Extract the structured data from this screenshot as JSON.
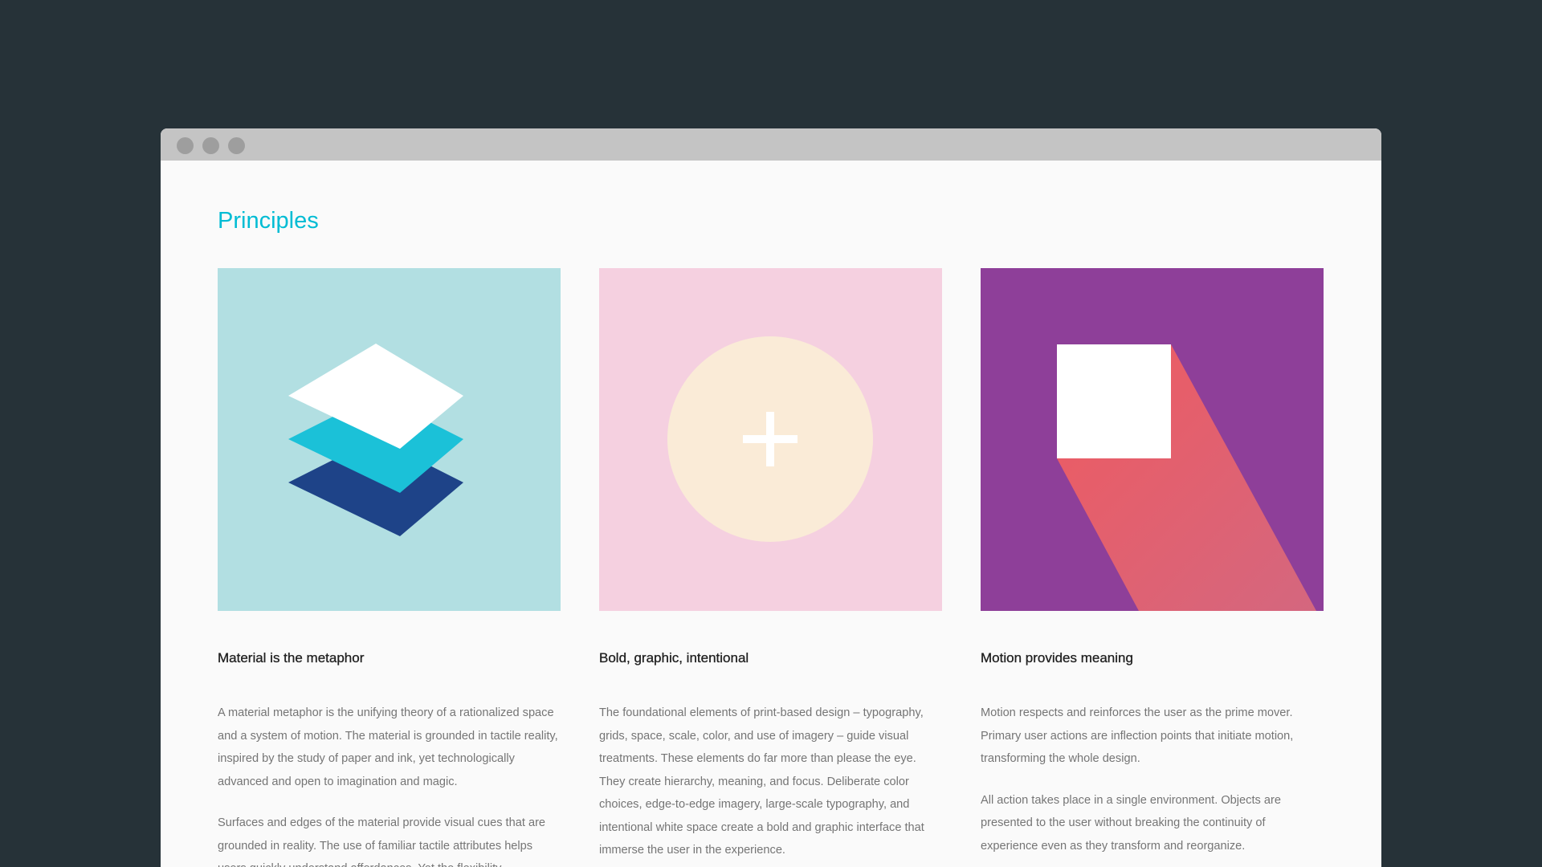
{
  "page": {
    "title": "Principles"
  },
  "window": {
    "titlebar_color": "#c4c4c4",
    "dot_color": "#9e9e9e"
  },
  "cards": [
    {
      "title": "Material is the metaphor",
      "illustration": "layers-icon",
      "background": "#b2dfe2",
      "paragraphs": [
        "A material metaphor is the unifying theory of a rationalized space and a system of motion. The material is grounded in tactile reality, inspired by the study of paper and ink, yet technologically advanced and open to imagination and magic.",
        "Surfaces and edges of the material provide visual cues that are grounded in reality. The use of familiar tactile attributes helps users quickly understand affordances. Yet the flexibility"
      ]
    },
    {
      "title": "Bold, graphic, intentional",
      "illustration": "plus-circle-icon",
      "background": "#f5d0e0",
      "paragraphs": [
        "The foundational elements of print-based design – typography, grids, space, scale, color, and use of imagery – guide visual treatments. These elements do far more than please the eye. They create hierarchy, meaning, and focus. Deliberate color choices, edge-to-edge imagery, large-scale typography, and intentional white space create a bold and graphic interface that immerse the user in the experience."
      ]
    },
    {
      "title": "Motion provides meaning",
      "illustration": "square-shadow-icon",
      "background": "#8e3f99",
      "paragraphs": [
        "Motion respects and reinforces the user as the prime mover. Primary user actions are inflection points that initiate motion, transforming the whole design.",
        "All action takes place in a single environment. Objects are presented to the user without breaking the continuity of experience even as they transform and reorganize."
      ]
    }
  ],
  "colors": {
    "accent": "#00bcd4",
    "background": "#263238",
    "page": "#fafafa"
  }
}
